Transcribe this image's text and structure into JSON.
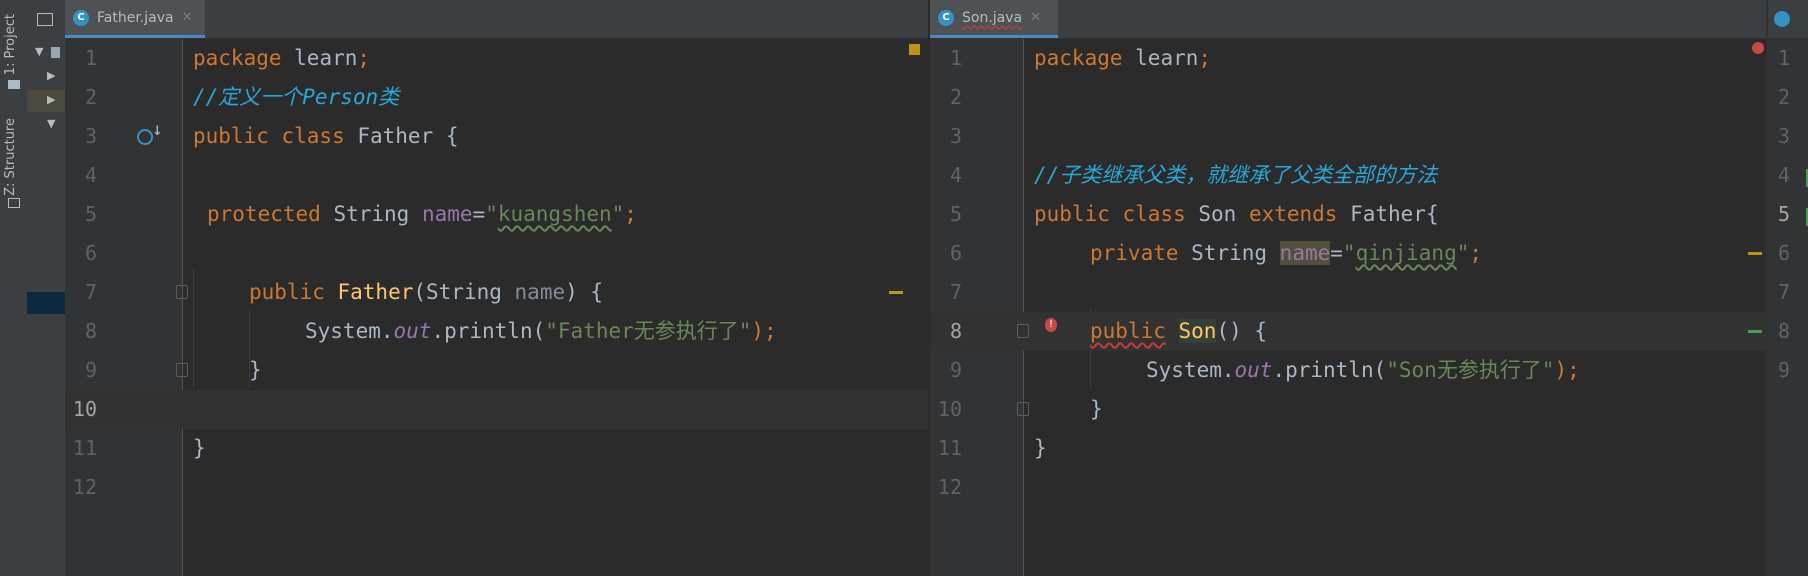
{
  "sidebar": {
    "project_tab": "1: Project",
    "structure_tab": "Z: Structure"
  },
  "left_editor": {
    "tab_label": "Father.java",
    "line_numbers": [
      "1",
      "2",
      "3",
      "4",
      "5",
      "6",
      "7",
      "8",
      "9",
      "10",
      "11",
      "12"
    ],
    "current_line": "10"
  },
  "right_editor": {
    "tab_label": "Son.java",
    "line_numbers": [
      "1",
      "2",
      "3",
      "4",
      "5",
      "6",
      "7",
      "8",
      "9",
      "10",
      "11",
      "12"
    ],
    "current_line": "8"
  },
  "third_editor": {
    "tab_label": "",
    "line_numbers": [
      "1",
      "2",
      "3",
      "4",
      "5",
      "6",
      "7",
      "8",
      "9"
    ]
  },
  "code_left": {
    "l1_kw": "package",
    "l1_rest": " learn",
    "l1_semi": ";",
    "l2_comment": "//定义一个Person类",
    "l3_kw1": "public",
    "l3_kw2": " class",
    "l3_rest": " Father {",
    "l5_kw": "protected",
    "l5_type": " String ",
    "l5_field": "name",
    "l5_eq": "=",
    "l5_q1": "\"",
    "l5_str": "kuangshen",
    "l5_q2": "\"",
    "l5_semi": ";",
    "l7_kw": "public",
    "l7_fn": " Father",
    "l7_open": "(String ",
    "l7_param": "name",
    "l7_close": ") {",
    "l8_sys": "System.",
    "l8_out": "out",
    "l8_println": ".println(",
    "l8_str": "\"Father无参执行了\"",
    "l8_end": ");",
    "l9": "}",
    "l11": "}"
  },
  "code_right": {
    "l1_kw": "package",
    "l1_rest": " learn",
    "l1_semi": ";",
    "l4_comment": "//子类继承父类，就继承了父类全部的方法",
    "l5_kw1": "public",
    "l5_kw2": " class",
    "l5_name": " Son ",
    "l5_kw3": "extends",
    "l5_rest": " Father{",
    "l6_kw": "private",
    "l6_type": " String ",
    "l6_field": "name",
    "l6_eq": "=",
    "l6_q1": "\"",
    "l6_str": "qinjiang",
    "l6_q2": "\"",
    "l6_semi": ";",
    "l8_kw": "public",
    "l8_fn": "Son",
    "l8_rest": "() {",
    "l9_sys": "System.",
    "l9_out": "out",
    "l9_println": ".println(",
    "l9_str": "\"Son无参执行了\"",
    "l9_end": ");",
    "l10": "}",
    "l11": "}"
  },
  "colors": {
    "keyword": "#cc7832",
    "string": "#6a8759",
    "comment": "#29a7d8",
    "field": "#9876aa",
    "method": "#ffc66d",
    "text": "#a9b7c6"
  }
}
